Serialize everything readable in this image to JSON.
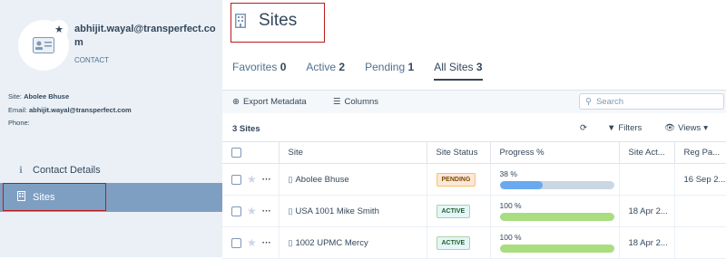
{
  "contact": {
    "email": "abhijit.wayal@transperfect.com",
    "type": "CONTACT",
    "site_label": "Site:",
    "site_value": "Abolee Bhuse",
    "email_label": "Email:",
    "email_value": "abhijit.wayal@transperfect.com",
    "phone_label": "Phone:"
  },
  "nav": {
    "items": [
      {
        "label": "Contact Details",
        "icon": "info-icon"
      },
      {
        "label": "Sites",
        "icon": "building-icon"
      }
    ]
  },
  "page": {
    "title": "Sites",
    "icon": "building-icon"
  },
  "tabs": [
    {
      "label": "Favorites",
      "count": "0"
    },
    {
      "label": "Active",
      "count": "2"
    },
    {
      "label": "Pending",
      "count": "1"
    },
    {
      "label": "All Sites",
      "count": "3"
    }
  ],
  "toolbar": {
    "export_label": "Export Metadata",
    "columns_label": "Columns",
    "search_placeholder": "Search"
  },
  "list": {
    "count_label": "3 Sites",
    "filters_label": "Filters",
    "views_label": "Views"
  },
  "table": {
    "headers": [
      "Site",
      "Site Status",
      "Progress %",
      "Site Act...",
      "Reg Pa..."
    ],
    "rows": [
      {
        "site": "Abolee Bhuse",
        "status": "PENDING",
        "progress_label": "38 %",
        "progress": 38,
        "site_act": "",
        "reg": "16 Sep 2..."
      },
      {
        "site": "USA 1001 Mike Smith",
        "status": "ACTIVE",
        "progress_label": "100 %",
        "progress": 100,
        "site_act": "18 Apr 2...",
        "reg": ""
      },
      {
        "site": "1002 UPMC Mercy",
        "status": "ACTIVE",
        "progress_label": "100 %",
        "progress": 100,
        "site_act": "18 Apr 2...",
        "reg": ""
      }
    ]
  },
  "colors": {
    "sidebar_bg": "#eaf0f6",
    "nav_active": "#7f9fc2",
    "highlight_border": "#b71c1c",
    "progress_partial": "#6aa9ef",
    "progress_full": "#a8de80"
  }
}
